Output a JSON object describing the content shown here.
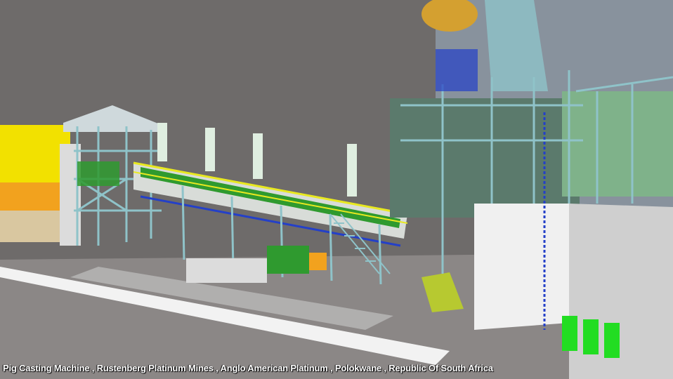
{
  "caption": "Pig Casting Machine , Rustenberg Platinum Mines , Anglo American Platinum , Polokwane , Republic Of South Africa",
  "colors": {
    "sky": "#6e6b6a",
    "steel": "#8fc3c9",
    "handrail": "#e8e820",
    "cable_tray": "#2440c8",
    "building_green": "#7fb28a",
    "machine_green": "#2f9a2f",
    "stack": "#dfeee0",
    "yellow_wall": "#f2e100",
    "orange_panel": "#f2a21e",
    "floor": "#8b8786",
    "concrete": "#e8e8e8"
  }
}
